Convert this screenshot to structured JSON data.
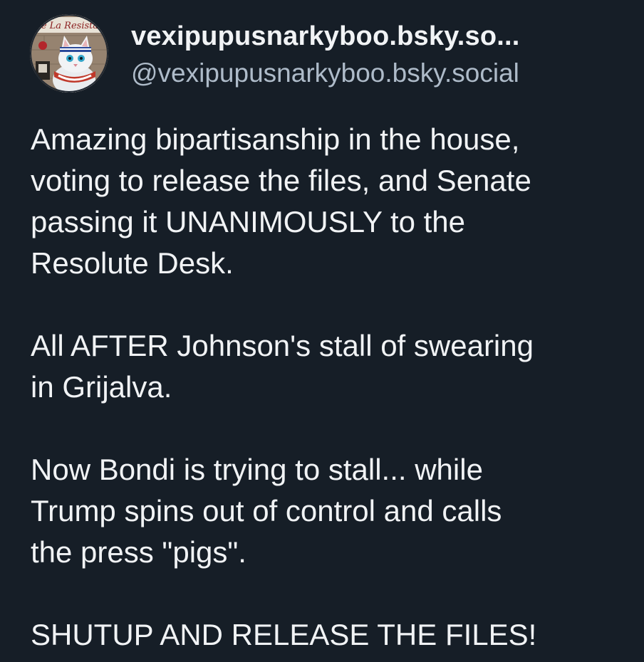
{
  "author": {
    "display_name": "vexipupusnarkyboo.bsky.so...",
    "handle": "@vexipupusnarkyboo.bsky.social",
    "avatar": {
      "icon": "cat-avatar-icon",
      "banner_text": "e La Resista"
    }
  },
  "post": {
    "paragraphs": [
      [
        "Amazing bipartisanship in the house,",
        "voting to release the files, and Senate",
        "passing it UNANIMOUSLY to the",
        "Resolute Desk."
      ],
      [
        "All AFTER Johnson's stall of swearing",
        "in Grijalva."
      ],
      [
        "Now Bondi is trying to stall... while",
        "Trump spins out of control and calls",
        "the press \"pigs\"."
      ],
      [
        "SHUTUP AND RELEASE THE FILES!"
      ]
    ]
  },
  "colors": {
    "background": "#161e27",
    "text": "#f1f3f5",
    "handle": "#aebbc9"
  }
}
